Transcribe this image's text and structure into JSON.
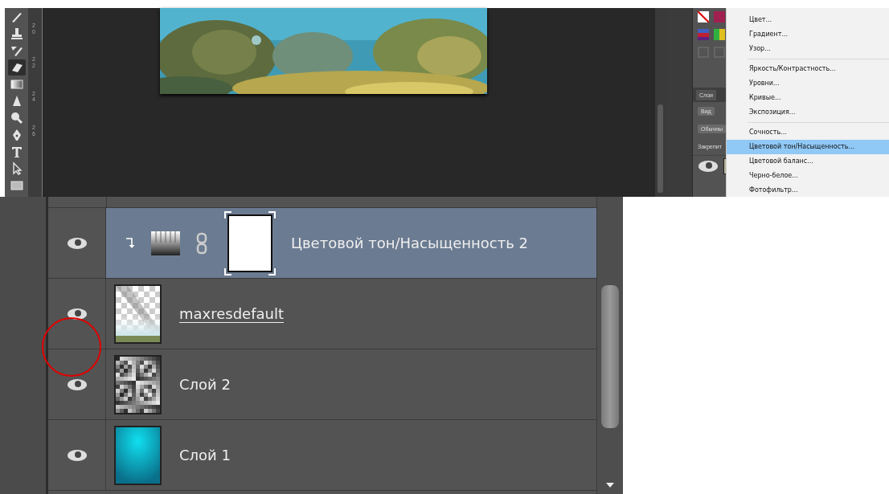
{
  "tools": [
    {
      "kind": "brush",
      "selected": false
    },
    {
      "kind": "stamp",
      "selected": false
    },
    {
      "kind": "history-brush",
      "selected": false
    },
    {
      "kind": "eraser",
      "selected": true
    },
    {
      "kind": "gradient",
      "selected": false
    },
    {
      "kind": "blur",
      "selected": false
    },
    {
      "kind": "dodge",
      "selected": false
    },
    {
      "kind": "pen",
      "selected": false
    },
    {
      "kind": "type",
      "selected": false
    },
    {
      "kind": "path-select",
      "selected": false
    },
    {
      "kind": "rectangle",
      "selected": false
    }
  ],
  "ruler": {
    "labels": [
      "20",
      "22",
      "24",
      "26"
    ]
  },
  "side_panel": {
    "tab": "Слои",
    "search": "Вид",
    "blend_mode": "Обычны",
    "lock_label": "Закрепит"
  },
  "menu": {
    "groups": [
      [
        {
          "label": "Цвет...",
          "selected": false
        },
        {
          "label": "Градиент...",
          "selected": false
        },
        {
          "label": "Узор...",
          "selected": false
        }
      ],
      [
        {
          "label": "Яркость/Контрастность...",
          "selected": false
        },
        {
          "label": "Уровни...",
          "selected": false
        },
        {
          "label": "Кривые...",
          "selected": false
        },
        {
          "label": "Экспозиция...",
          "selected": false
        }
      ],
      [
        {
          "label": "Сочность...",
          "selected": false
        },
        {
          "label": "Цветовой тон/Насыщенность...",
          "selected": true
        },
        {
          "label": "Цветовой баланс...",
          "selected": false
        },
        {
          "label": "Черно-белое...",
          "selected": false
        },
        {
          "label": "Фотофильтр...",
          "selected": false
        }
      ]
    ]
  },
  "layers": [
    {
      "kind": "adjustment",
      "name": "Цветовой тон/Насыщенность 2",
      "selected": true,
      "visible": true,
      "clipped": true,
      "underlined": false
    },
    {
      "kind": "transparent",
      "name": "maxresdefault",
      "selected": false,
      "visible": true,
      "clipped": false,
      "underlined": true
    },
    {
      "kind": "noise",
      "name": "Слой 2",
      "selected": false,
      "visible": true,
      "clipped": false,
      "underlined": false
    },
    {
      "kind": "gradient",
      "name": "Слой 1",
      "selected": false,
      "visible": true,
      "clipped": false,
      "underlined": false
    }
  ],
  "annotation": {
    "kind": "circle"
  }
}
